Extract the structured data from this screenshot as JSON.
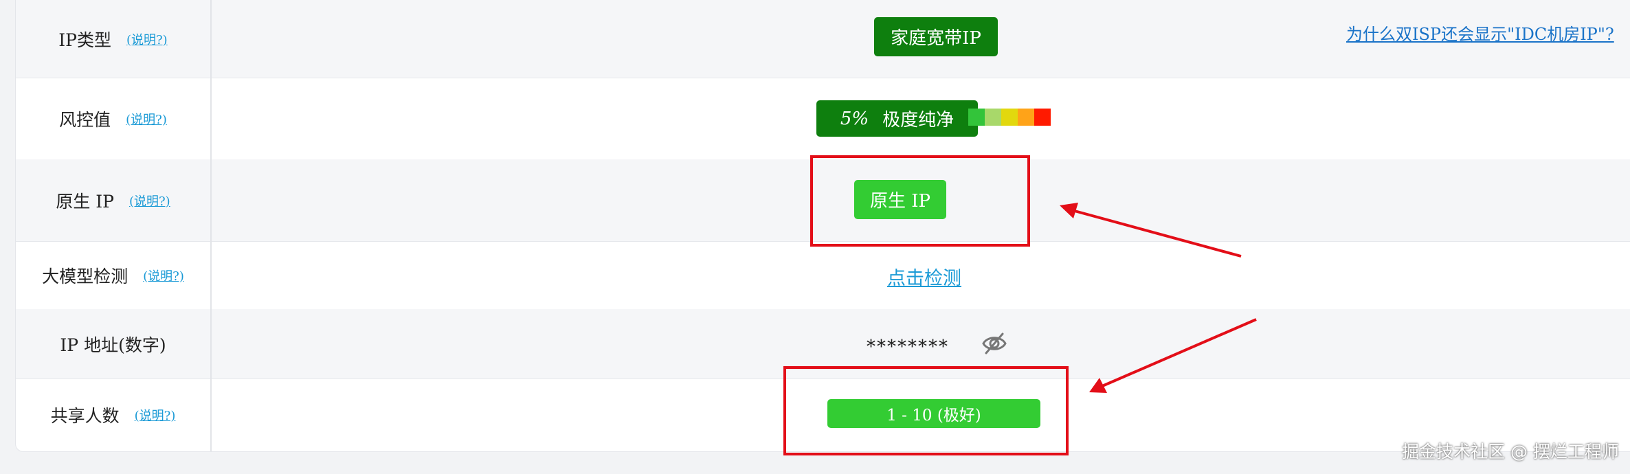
{
  "rows": [
    {
      "label": "IP类型",
      "help": "(说明?)",
      "badge": "家庭宽带IP",
      "link": "为什么双ISP还会显示\"IDC机房IP\"?"
    },
    {
      "label": "风控值",
      "help": "(说明?)",
      "score": "5%",
      "score_desc": "极度纯净"
    },
    {
      "label": "原生 IP",
      "help": "(说明?)",
      "badge": "原生 IP"
    },
    {
      "label": "大模型检测",
      "help": "(说明?)",
      "link": "点击检测"
    },
    {
      "label": "IP 地址(数字)",
      "masked": "********"
    },
    {
      "label": "共享人数",
      "help": "(说明?)",
      "badge": "1 - 10 (极好)"
    }
  ],
  "risk_scale": [
    "#33c43a",
    "#a8d86a",
    "#e2d80e",
    "#ffa318",
    "#ff1a00"
  ],
  "colors": {
    "dark_green": "#0e7f0e",
    "bright_green": "#33cc33",
    "link_blue": "#1a9ad6",
    "annotation_red": "#e30e18"
  },
  "icons": {
    "visibility": "eye-slash-icon"
  },
  "watermark": "掘金技术社区 @ 摆烂工程师"
}
